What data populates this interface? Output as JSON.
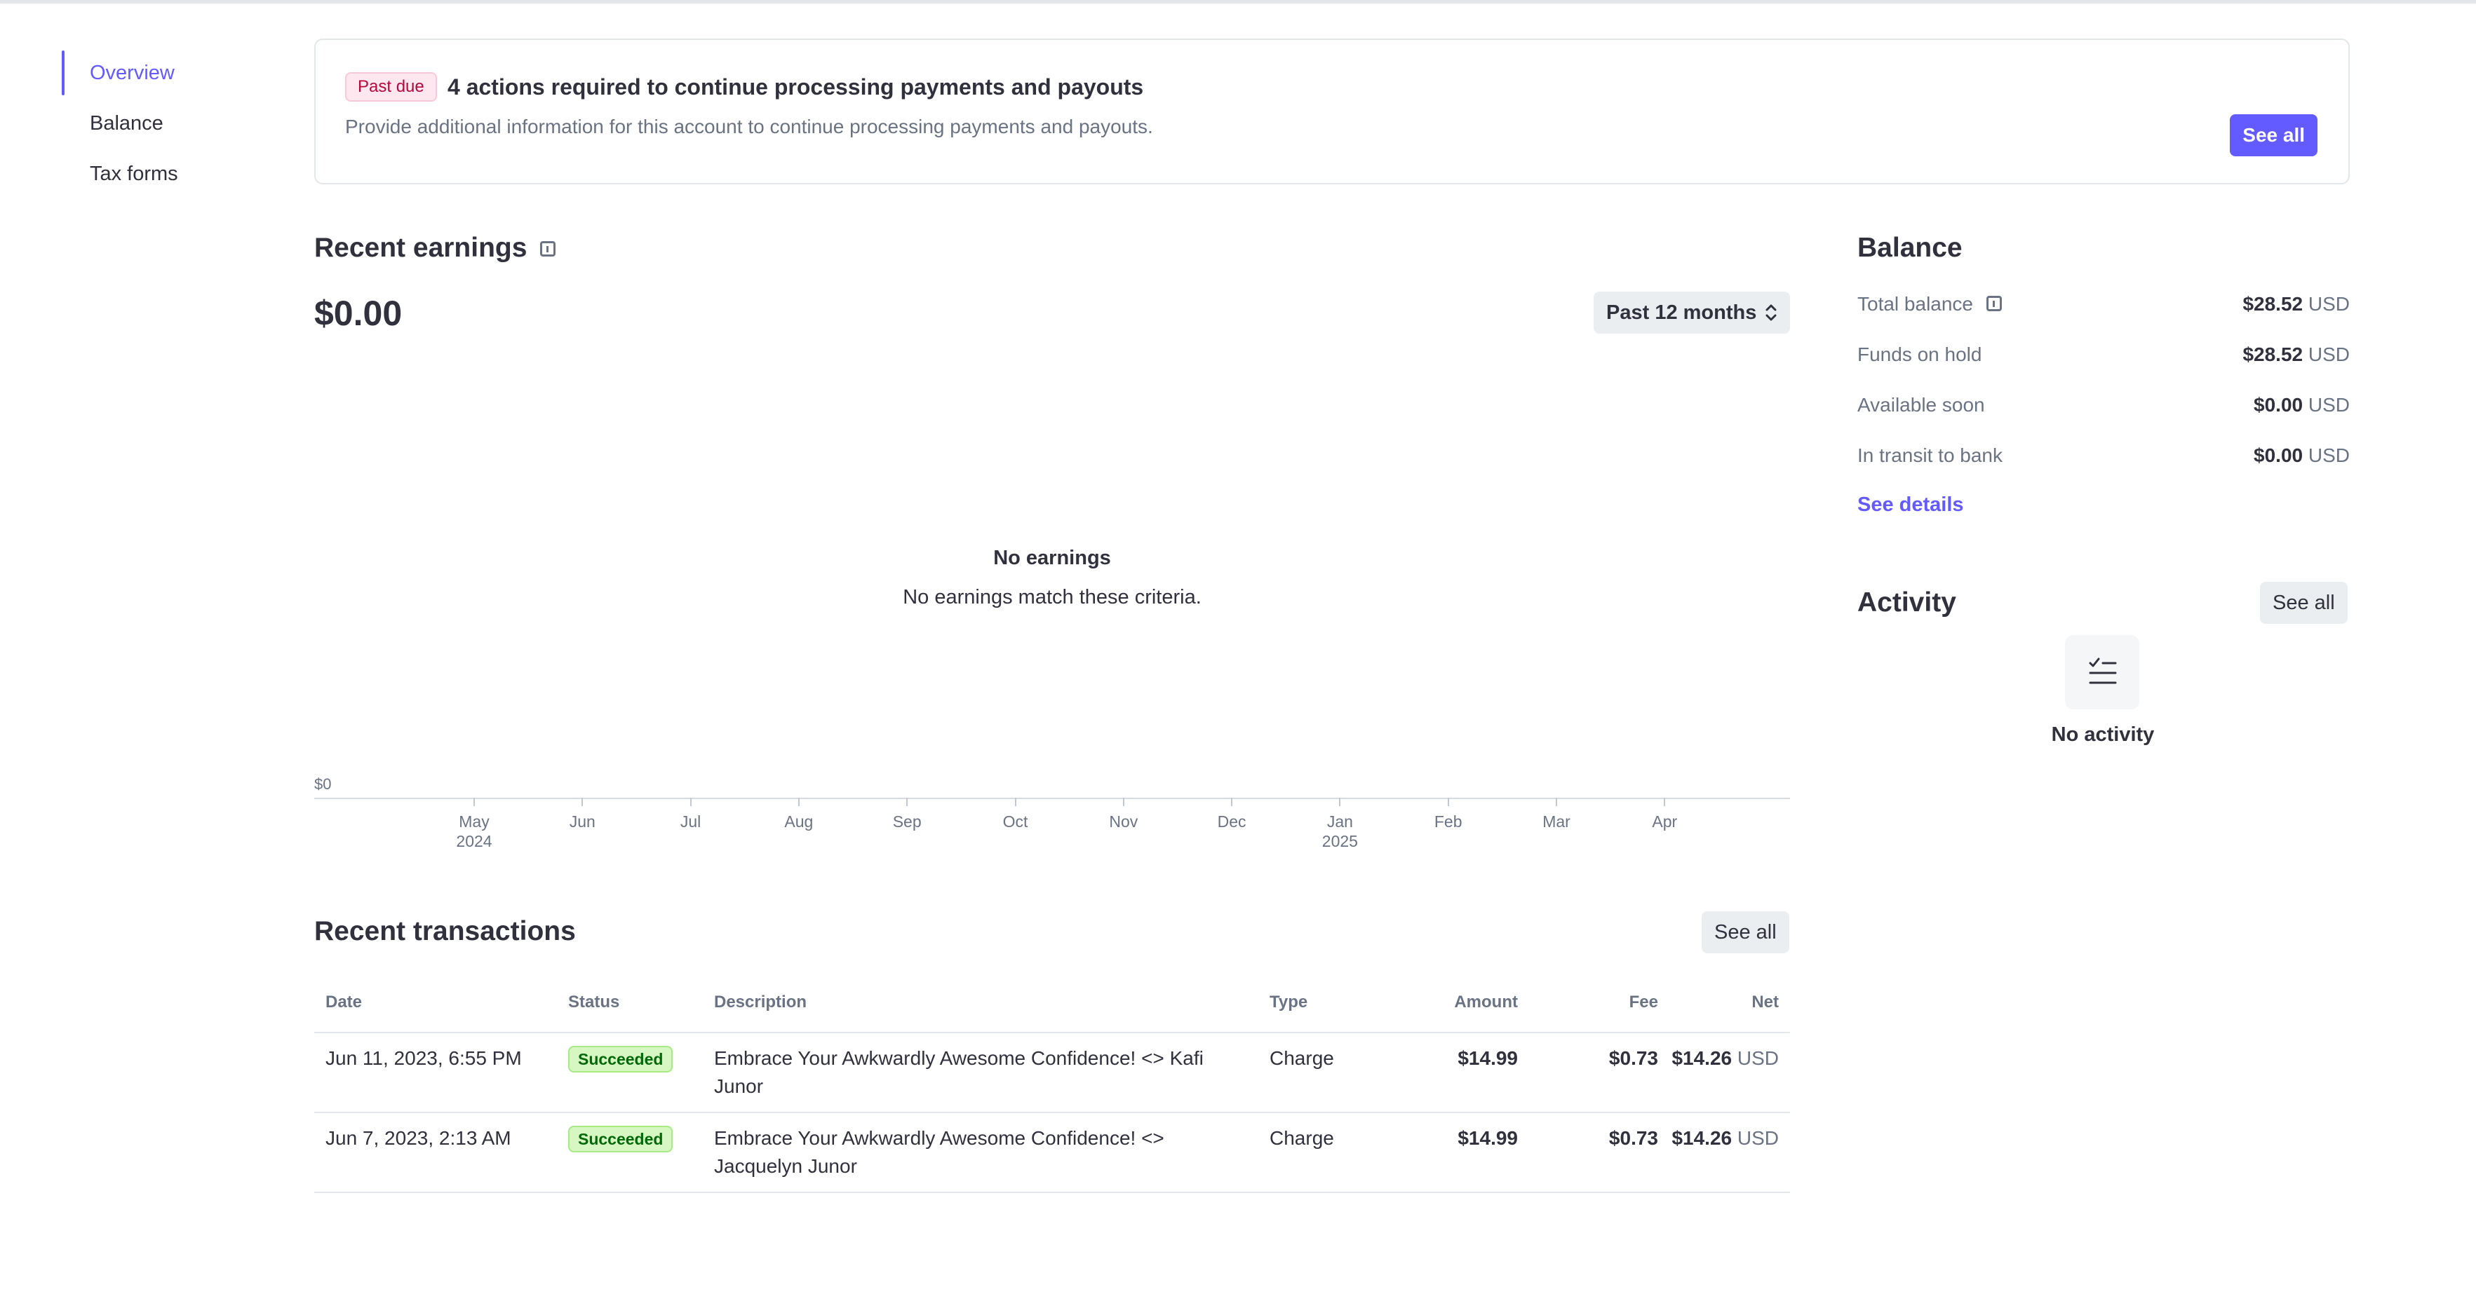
{
  "sidebar": {
    "items": [
      {
        "label": "Overview",
        "active": true
      },
      {
        "label": "Balance",
        "active": false
      },
      {
        "label": "Tax forms",
        "active": false
      }
    ]
  },
  "alert": {
    "badge": "Past due",
    "title": "4 actions required to continue processing payments and payouts",
    "description": "Provide additional information for this account to continue processing payments and payouts.",
    "button": "See all"
  },
  "earnings": {
    "title": "Recent earnings",
    "amount": "$0.00",
    "period": "Past 12 months",
    "empty_title": "No earnings",
    "empty_desc": "No earnings match these criteria.",
    "y_zero_label": "$0"
  },
  "chart_data": {
    "type": "bar",
    "categories": [
      "May 2024",
      "Jun",
      "Jul",
      "Aug",
      "Sep",
      "Oct",
      "Nov",
      "Dec",
      "Jan 2025",
      "Feb",
      "Mar",
      "Apr"
    ],
    "values": [],
    "title": "",
    "xlabel": "",
    "ylabel": "",
    "ytick_labels": [
      "$0"
    ],
    "x_tick_labels": [
      {
        "month": "May",
        "year": "2024"
      },
      {
        "month": "Jun",
        "year": ""
      },
      {
        "month": "Jul",
        "year": ""
      },
      {
        "month": "Aug",
        "year": ""
      },
      {
        "month": "Sep",
        "year": ""
      },
      {
        "month": "Oct",
        "year": ""
      },
      {
        "month": "Nov",
        "year": ""
      },
      {
        "month": "Dec",
        "year": ""
      },
      {
        "month": "Jan",
        "year": "2025"
      },
      {
        "month": "Feb",
        "year": ""
      },
      {
        "month": "Mar",
        "year": ""
      },
      {
        "month": "Apr",
        "year": ""
      }
    ],
    "grid": false
  },
  "transactions": {
    "title": "Recent transactions",
    "see_all": "See all",
    "headers": {
      "date": "Date",
      "status": "Status",
      "description": "Description",
      "type": "Type",
      "amount": "Amount",
      "fee": "Fee",
      "net": "Net"
    },
    "rows": [
      {
        "date": "Jun 11, 2023, 6:55 PM",
        "status": "Succeeded",
        "desc_line1": "Embrace Your Awkwardly Awesome Confidence! <> Kafi",
        "desc_line2": "Junor",
        "type": "Charge",
        "amount": "$14.99",
        "fee": "$0.73",
        "net": "$14.26",
        "currency": "USD"
      },
      {
        "date": "Jun 7, 2023, 2:13 AM",
        "status": "Succeeded",
        "desc_line1": "Embrace Your Awkwardly Awesome Confidence! <>",
        "desc_line2": "Jacquelyn Junor",
        "type": "Charge",
        "amount": "$14.99",
        "fee": "$0.73",
        "net": "$14.26",
        "currency": "USD"
      }
    ]
  },
  "balance": {
    "title": "Balance",
    "rows": [
      {
        "label": "Total balance",
        "value": "$28.52",
        "currency": "USD"
      },
      {
        "label": "Funds on hold",
        "value": "$28.52",
        "currency": "USD"
      },
      {
        "label": "Available soon",
        "value": "$0.00",
        "currency": "USD"
      },
      {
        "label": "In transit to bank",
        "value": "$0.00",
        "currency": "USD"
      }
    ],
    "details_link": "See details"
  },
  "activity": {
    "title": "Activity",
    "see_all": "See all",
    "empty": "No activity",
    "icon": "checklist-icon"
  },
  "colors": {
    "accent": "#635bff",
    "text": "#30313d",
    "muted": "#6a7383",
    "past_due_bg": "#ffe7f0",
    "success_bg": "#d7f7c2"
  }
}
